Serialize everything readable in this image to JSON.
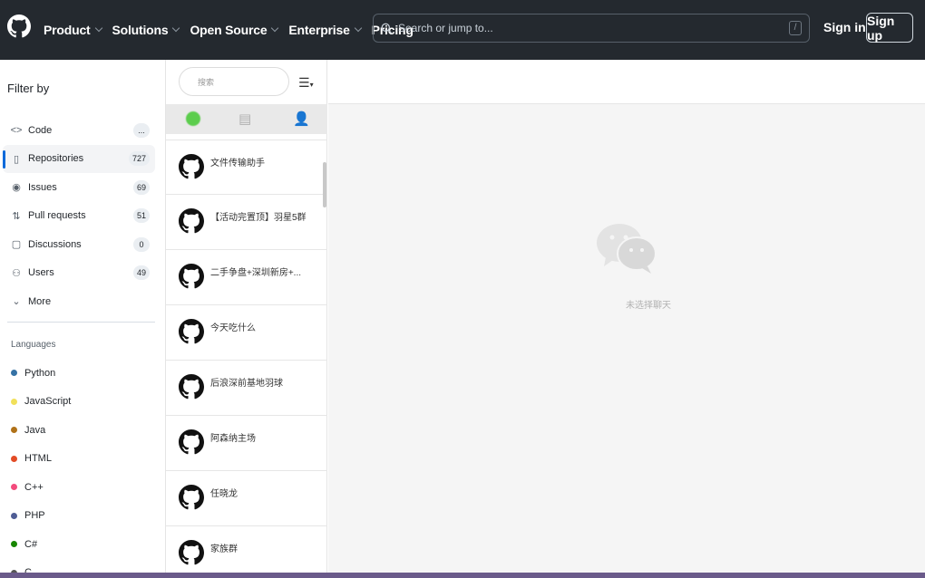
{
  "header": {
    "nav": [
      {
        "label": "Product",
        "has_menu": true
      },
      {
        "label": "Solutions",
        "has_menu": true
      },
      {
        "label": "Open Source",
        "has_menu": true
      },
      {
        "label": "Enterprise",
        "has_menu": true
      },
      {
        "label": "Pricing",
        "has_menu": false
      }
    ],
    "search_placeholder": "Search or jump to...",
    "search_shortcut": "/",
    "sign_in": "Sign in",
    "sign_up": "Sign up"
  },
  "sidebar": {
    "title": "Filter by",
    "filters": [
      {
        "label": "Code",
        "count": "...",
        "icon": "code-icon",
        "glyph": "<>",
        "active": false
      },
      {
        "label": "Repositories",
        "count": "727",
        "icon": "repo-icon",
        "glyph": "▯",
        "active": true
      },
      {
        "label": "Issues",
        "count": "69",
        "icon": "issue-icon",
        "glyph": "◉",
        "active": false
      },
      {
        "label": "Pull requests",
        "count": "51",
        "icon": "pull-request-icon",
        "glyph": "⇅",
        "active": false
      },
      {
        "label": "Discussions",
        "count": "0",
        "icon": "discussion-icon",
        "glyph": "▢",
        "active": false
      },
      {
        "label": "Users",
        "count": "49",
        "icon": "people-icon",
        "glyph": "⚇",
        "active": false
      },
      {
        "label": "More",
        "count": "",
        "icon": "chevron-down-icon",
        "glyph": "⌄",
        "active": false
      }
    ],
    "languages_title": "Languages",
    "languages": [
      {
        "label": "Python",
        "color": "#3572A5"
      },
      {
        "label": "JavaScript",
        "color": "#f1e05a"
      },
      {
        "label": "Java",
        "color": "#b07219"
      },
      {
        "label": "HTML",
        "color": "#e34c26"
      },
      {
        "label": "C++",
        "color": "#f34b7d"
      },
      {
        "label": "PHP",
        "color": "#4F5D95"
      },
      {
        "label": "C#",
        "color": "#178600"
      },
      {
        "label": "C",
        "color": "#555555"
      }
    ]
  },
  "chat": {
    "search_placeholder": "搜索",
    "items": [
      {
        "name": "文件传输助手"
      },
      {
        "name": "【活动完置顶】羽星5群"
      },
      {
        "name": "二手争盘+深圳新房+..."
      },
      {
        "name": "今天吃什么"
      },
      {
        "name": "后浪深前基地羽球"
      },
      {
        "name": "阿森纳主场"
      },
      {
        "name": "任晓龙"
      },
      {
        "name": "家族群"
      }
    ]
  },
  "content": {
    "empty_text": "未选择聊天"
  }
}
